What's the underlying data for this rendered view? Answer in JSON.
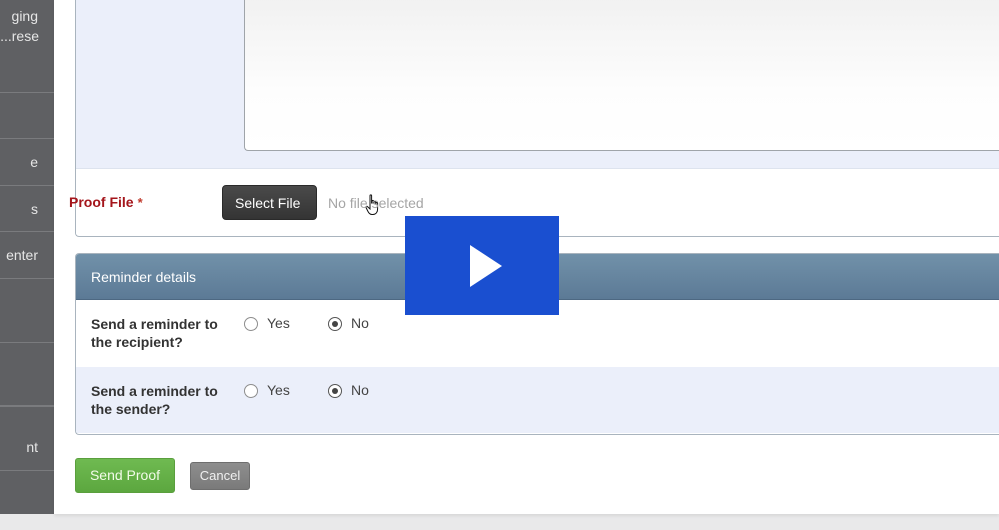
{
  "sidebar": {
    "items": [
      {
        "label_line1": "ging",
        "label_line2": "rese..."
      },
      {
        "label": ""
      },
      {
        "label": "e"
      },
      {
        "label": "s"
      },
      {
        "label": "enter"
      },
      {
        "label": ""
      },
      {
        "label": ""
      },
      {
        "label": ""
      },
      {
        "label": "nt"
      },
      {
        "label": ""
      }
    ]
  },
  "proof": {
    "label": "Proof File",
    "required_marker": "*",
    "select_button_label": "Select File",
    "file_status": "No file selected"
  },
  "reminder": {
    "title": "Reminder details",
    "rows": [
      {
        "question": "Send a reminder to the recipient?",
        "options": [
          "Yes",
          "No"
        ],
        "selected": "No"
      },
      {
        "question": "Send a reminder to the sender?",
        "options": [
          "Yes",
          "No"
        ],
        "selected": "No"
      }
    ]
  },
  "actions": {
    "send_label": "Send Proof",
    "cancel_label": "Cancel"
  },
  "overlay": {
    "icon": "play-icon",
    "color": "#1a4fd0"
  },
  "colors": {
    "sidebar_bg": "#5f6063",
    "required_label": "#a4151b",
    "section_header": "#6787a0",
    "send_button": "#64ae47",
    "cancel_button": "#848484"
  }
}
